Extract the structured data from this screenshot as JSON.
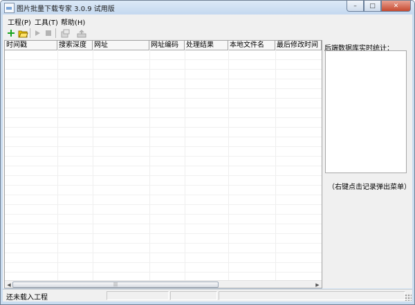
{
  "window": {
    "title": "图片批量下载专家 3.0.9 试用版",
    "buttons": {
      "minimize": "–",
      "maximize": "□",
      "close": "✕"
    }
  },
  "menu": {
    "items": [
      {
        "label": "工程(P)"
      },
      {
        "label": "工具(T)"
      },
      {
        "label": "帮助(H)"
      }
    ]
  },
  "toolbar": {
    "icons": [
      "add-icon",
      "open-folder-icon",
      "play-icon",
      "stop-icon",
      "build-icon",
      "export-icon"
    ],
    "colors": {
      "add": "#16a31d",
      "folder": "#f0c400",
      "disabled": "#b3b3b3"
    }
  },
  "table": {
    "columns": [
      {
        "label": "时间戳"
      },
      {
        "label": "搜索深度"
      },
      {
        "label": "网址"
      },
      {
        "label": "网址编码"
      },
      {
        "label": "处理结果"
      },
      {
        "label": "本地文件名"
      },
      {
        "label": "最后修改时间"
      }
    ],
    "scroll_arrows": {
      "left": "◀",
      "right": "▶",
      "thumb": "|||"
    }
  },
  "side_panel": {
    "title": "后端数据库实时统计：",
    "hint": "（右键点击记录弹出菜单）"
  },
  "statusbar": {
    "text": "还未载入工程"
  }
}
